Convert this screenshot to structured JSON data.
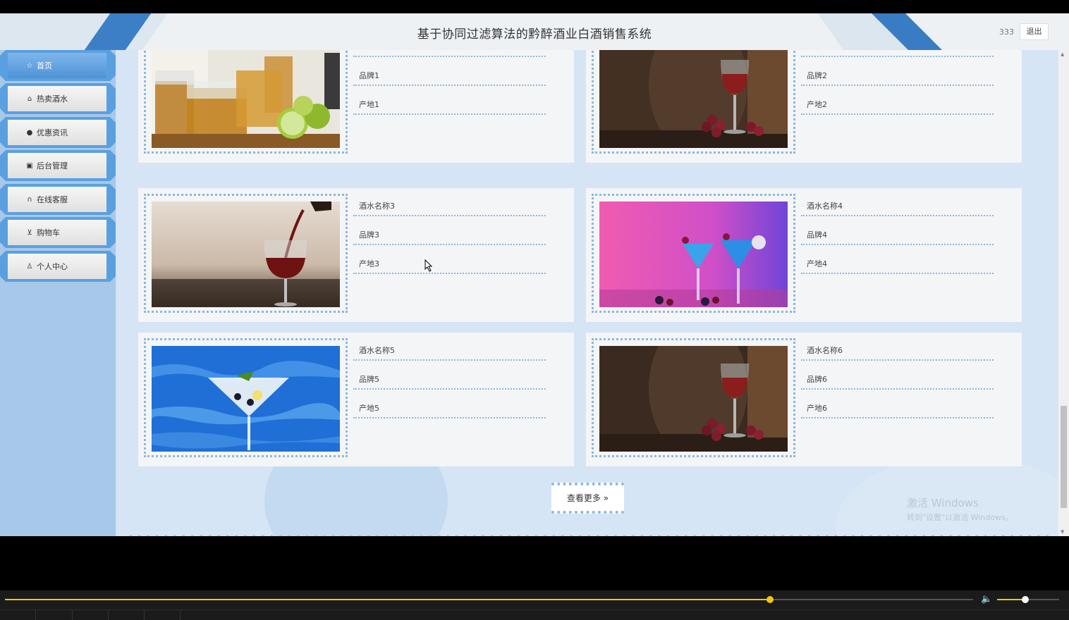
{
  "header": {
    "title": "基于协同过滤算法的黔醉酒业白酒销售系统",
    "username": "333",
    "logout_label": "退出"
  },
  "sidebar": {
    "items": [
      {
        "label": "首页",
        "icon": "star-icon",
        "active": true
      },
      {
        "label": "热卖酒水",
        "icon": "bag-icon",
        "active": false
      },
      {
        "label": "优惠资讯",
        "icon": "info-icon",
        "active": false
      },
      {
        "label": "后台管理",
        "icon": "building-icon",
        "active": false
      },
      {
        "label": "在线客服",
        "icon": "headset-icon",
        "active": false
      },
      {
        "label": "购物车",
        "icon": "cart-icon",
        "active": false
      },
      {
        "label": "个人中心",
        "icon": "user-icon",
        "active": false
      }
    ]
  },
  "products": [
    {
      "name": "",
      "brand": "品牌1",
      "origin": "产地1",
      "image": "whiskey-glasses-with-lime"
    },
    {
      "name": "",
      "brand": "品牌2",
      "origin": "产地2",
      "image": "red-wine-glass-barrel-grapes"
    },
    {
      "name": "酒水名称3",
      "brand": "品牌3",
      "origin": "产地3",
      "image": "red-wine-pouring"
    },
    {
      "name": "酒水名称4",
      "brand": "品牌4",
      "origin": "产地4",
      "image": "blue-cocktails-pink-background"
    },
    {
      "name": "酒水名称5",
      "brand": "品牌5",
      "origin": "产地5",
      "image": "martini-blue-water"
    },
    {
      "name": "酒水名称6",
      "brand": "品牌6",
      "origin": "产地6",
      "image": "red-wine-glass-barrel-grapes"
    }
  ],
  "more_button": {
    "label": "查看更多",
    "icon": "double-chevron-right-icon"
  },
  "watermark": {
    "title": "激活 Windows",
    "subtitle": "转到\"设置\"以激活 Windows。"
  },
  "player": {
    "progress": 0.79,
    "volume": 0.45
  },
  "colors": {
    "accent": "#4f93d6",
    "dotted": "#8db7de",
    "progress": "#f0c419"
  }
}
